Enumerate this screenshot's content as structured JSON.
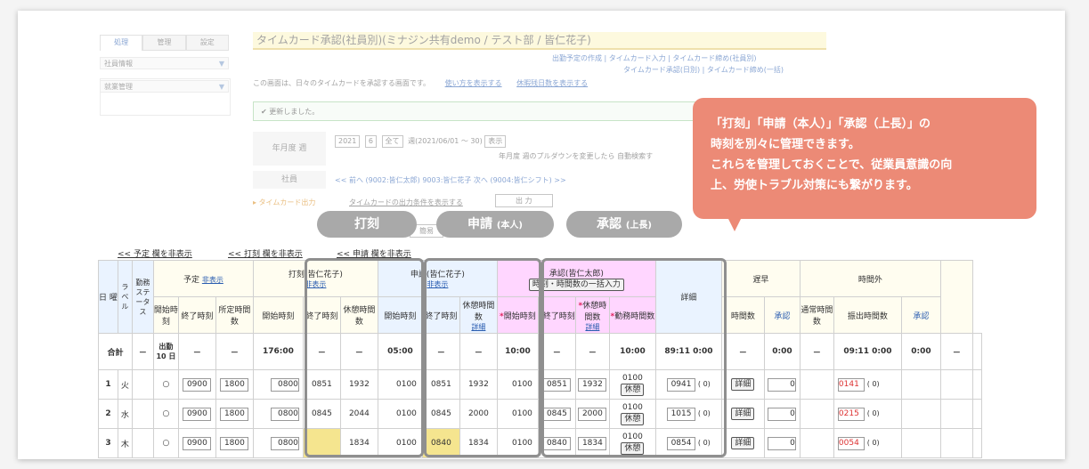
{
  "sidebar": {
    "tabs": [
      "処理",
      "管理",
      "設定"
    ],
    "items": [
      "社員情報",
      "就業管理"
    ]
  },
  "page": {
    "title": "タイムカード承認(社員別)(ミナジン共有demo / テスト部 / 皆仁花子)",
    "toplinks_line1": "出勤予定の作成 | タイムカード入力 | タイムカード締め(社員別)",
    "toplinks_line2": "タイムカード承認(日別) | タイムカード締め(一括)",
    "desc": "この画面は、日々のタイムカードを承認する画面です。",
    "link_howto": "使い方を表示する",
    "link_leave": "休暇残日数を表示する",
    "message": "✔ 更新しました。",
    "period_label": "年月度 週",
    "year": "2021",
    "month": "6",
    "week": "全て",
    "week_range": "週(2021/06/01 ～ 30)",
    "show_btn": "表示",
    "period_hint": "年月度 週のプルダウンを変更したら 自動検索す",
    "employee_label": "社員",
    "employee_nav": "<< 前へ (9002:皆仁太郎)    9003:皆仁花子    次へ (9004:皆仁シフト) >>",
    "output_label": "▸ タイムカード出力",
    "output_link": "タイムカードの出力条件を表示する",
    "output_btn": "出 力",
    "simple_btn": "簡易"
  },
  "pills": {
    "punch": "打刻",
    "apply": "申請",
    "apply_sub": "(本人)",
    "approve": "承認",
    "approve_sub": "(上長)"
  },
  "bubble": {
    "line1": "「打刻」「申請（本人）」「承認（上長）」の",
    "line2": "時刻を別々に管理できます。",
    "line3": "これらを管理しておくことで、従業員意識の向",
    "line4": "上、労使トラブル対策にも繋がります。"
  },
  "toggles": {
    "plan": "<< 予定 欄を非表示",
    "punch": "<< 打刻 欄を非表示",
    "apply": "<< 申請 欄を非表示"
  },
  "table": {
    "h_day": "日",
    "h_week": "曜",
    "h_label": "ラベル",
    "h_status": "勤務ステータス",
    "plan": "予定",
    "plan_hide": "非表示",
    "punch": "打刻(皆仁花子)",
    "punch_hide": "非表示",
    "apply": "申請(皆仁花子)",
    "apply_hide": "非表示",
    "approve": "承認(皆仁太郎)",
    "approve_btn": "時刻・時間数の一括入力",
    "detail": "詳細",
    "late": "遅早",
    "overtime": "時間外",
    "c_start": "開始時刻",
    "c_end": "終了時刻",
    "c_sched": "所定時間数",
    "c_break": "休憩時間数",
    "c_detail": "詳細",
    "c_work": "勤務時間数",
    "c_hours": "時間数",
    "c_appr": "承認",
    "c_normal": "通常時間数",
    "c_shift": "振出時間数",
    "sum_label": "合計",
    "sum_dash": "－",
    "sum_days": "出勤 10 日",
    "sum_sched": "176:00",
    "sum_pbreak": "05:00",
    "sum_abreak": "10:00",
    "sum_apbreak": "10:00",
    "sum_work": "89:11 0:00",
    "sum_late": "0:00",
    "sum_ot": "09:11 0:00",
    "sum_shift": "0:00",
    "rows": [
      {
        "day": "1",
        "dow": "火",
        "st": "○",
        "ps": "0900",
        "pe": "1800",
        "pd": "0800",
        "ks": "0851",
        "ke": "1932",
        "kb": "0100",
        "as": "0851",
        "ae": "1932",
        "ab": "0100",
        "rs": "0851",
        "re": "1932",
        "rb": "0100",
        "rw": "0941",
        "late": "0",
        "ot": "0141"
      },
      {
        "day": "2",
        "dow": "水",
        "st": "○",
        "ps": "0900",
        "pe": "1800",
        "pd": "0800",
        "ks": "0845",
        "ke": "2044",
        "kb": "0100",
        "as": "0845",
        "ae": "2000",
        "ab": "0100",
        "rs": "0845",
        "re": "2000",
        "rb": "0100",
        "rw": "1015",
        "late": "0",
        "ot": "0215"
      },
      {
        "day": "3",
        "dow": "木",
        "st": "○",
        "ps": "0900",
        "pe": "1800",
        "pd": "0800",
        "ks": "",
        "ke": "1834",
        "kb": "0100",
        "as": "0840",
        "ae": "1834",
        "ab": "0100",
        "rs": "0840",
        "re": "1834",
        "rb": "0100",
        "rw": "0854",
        "late": "0",
        "ot": "0054"
      }
    ],
    "break_btn": "休憩",
    "detail_btn": "詳細",
    "paren": "(   0)"
  }
}
